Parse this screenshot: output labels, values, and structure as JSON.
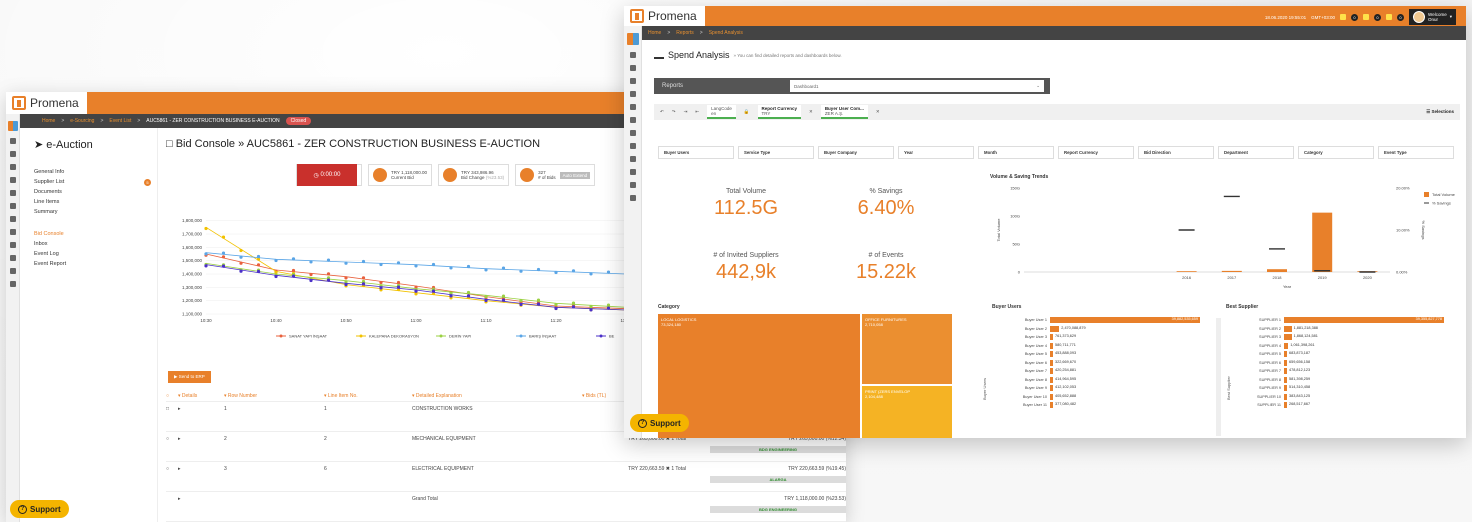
{
  "back": {
    "logo": "Promena",
    "breadcrumb": {
      "home": "Home",
      "sep1": ">",
      "sourcing": "e-Sourcing",
      "sep2": ">",
      "eventlist": "Event List",
      "sep3": ">",
      "current": "AUC5861 - ZER CONSTRUCTION BUSINESS E-AUCTION",
      "status": "Closed"
    },
    "nav_title": "e-Auction",
    "nav_items": [
      "General Info",
      "Supplier List",
      "Documents",
      "Line Items",
      "Summary",
      "Bid Console",
      "Inbox",
      "Event Log",
      "Event Report"
    ],
    "supplier_badge": "5",
    "page_title": "Bid Console » AUC5861 - ZER CONSTRUCTION BUSINESS E-AUCTION",
    "timer": "0:00:00",
    "current_bid_value": "TRY 1,118,000.00",
    "current_bid_label": "Current Bid",
    "bid_change_value": "TRY 343,986.96",
    "bid_change_pct": "(%23.53)",
    "bid_change_label": "Bid Change",
    "bids_count": "327",
    "bids_label": "# of Bids",
    "status_tag": "Auto Extend",
    "yticks": [
      "1,800,000",
      "1,700,000",
      "1,600,000",
      "1,500,000",
      "1,400,000",
      "1,300,000",
      "1,200,000",
      "1,100,000"
    ],
    "xticks": [
      "10:30",
      "10:40",
      "10:50",
      "11:00",
      "11:10",
      "11:20",
      "11:30"
    ],
    "legend": [
      "SANAT YAPI İNŞAAT",
      "KALEPANA DEKORASYON",
      "DERİN YAPI",
      "BARIŞ İNŞAAT",
      "BE"
    ],
    "send_button": "Send to ERP",
    "table_headers": [
      "",
      "Details",
      "Row Number",
      "Line Item No.",
      "Detailed Explanation",
      "Bids (TL)"
    ],
    "rows": [
      {
        "row": "1",
        "item": "1",
        "desc": "CONSTRUCTION WORKS",
        "total": "",
        "bid": "",
        "supplier": ""
      },
      {
        "row": "2",
        "item": "2",
        "desc": "MECHANICAL EQUIPMENT",
        "total": "TRY 265,000.00 ✖ 1 Total",
        "bid": "TRY 265,000.00 (%12.34)",
        "supplier": "BDG ENGINEERING"
      },
      {
        "row": "3",
        "item": "6",
        "desc": "ELECTRICAL EQUIPMENT",
        "total": "TRY 220,663.59 ✖ 1 Total",
        "bid": "TRY 220,663.59 (%19.45)",
        "supplier": "ALARGA"
      }
    ],
    "grand_total_label": "Grand Total",
    "grand_total_bid": "TRY 1,118,000.00 (%23.53)",
    "grand_total_supplier": "BDG ENGINEERING",
    "support": "Support"
  },
  "front": {
    "logo": "Promena",
    "datetime": "18.06.2020 19:55:01",
    "tz": "GMT+03:00",
    "notif_counts": [
      "0",
      "0",
      "0"
    ],
    "welcome": "Welcome",
    "user": "Onur",
    "breadcrumb": {
      "home": "Home",
      "sep1": ">",
      "reports": "Reports",
      "sep2": ">",
      "current": "Spend Analysis"
    },
    "title": "Spend Analysis",
    "subtitle": "» You can find detailed reports and dashboards below.",
    "reports_label": "Reports",
    "dashboard": "Dashboard1",
    "tool_chips": [
      {
        "label": "LangCode",
        "value": "en"
      },
      {
        "label": "Report Currency",
        "value": "TRY"
      },
      {
        "label": "Buyer User Com...",
        "value": "ZER A.Ş."
      }
    ],
    "selections": "Selections",
    "filters": [
      "Buyer Users",
      "Service Type",
      "Buyer Company",
      "Year",
      "Month",
      "Report Currency",
      "Bid Direction",
      "Department",
      "Category",
      "Event Type"
    ],
    "kpis": [
      {
        "label": "Total Volume",
        "value": "112.5G"
      },
      {
        "label": "% Savings",
        "value": "6.40%"
      },
      {
        "label": "# of Invited Suppliers",
        "value": "442,9k"
      },
      {
        "label": "# of Events",
        "value": "15.22k"
      }
    ],
    "trend_title": "Volume & Saving Trends",
    "trend_ylabel": "Total Volume",
    "trend_y2label": "% Savings",
    "trend_yticks": [
      "150G",
      "100G",
      "50G",
      "0"
    ],
    "trend_y2ticks": [
      "20.00%",
      "10.00%",
      "0.00%"
    ],
    "trend_xlabel": "Year",
    "trend_legend": [
      "Total Volume",
      "% Savings"
    ],
    "category_title": "Category",
    "treemap": [
      {
        "name": "LOCAL LOGISTICS",
        "value": "73,324,180"
      },
      {
        "name": "OFFICE FURNITURES",
        "value": "2,710,058"
      },
      {
        "name": "PRINT (ZERS ENVELOP",
        "value": "2,104,488"
      }
    ],
    "buyer_users_title": "Buyer Users",
    "buyer_users_axis": "Buyer Users",
    "buyer_users": [
      {
        "name": "Buyer User 1",
        "value": "39,882,535,659"
      },
      {
        "name": "Buyer User 2",
        "value": "2,470,088,879"
      },
      {
        "name": "Buyer User 3",
        "value": "761,373,629"
      },
      {
        "name": "Buyer User 4",
        "value": "580,711,771"
      },
      {
        "name": "Buyer User 5",
        "value": "453,888,093"
      },
      {
        "name": "Buyer User 6",
        "value": "322,669,670"
      },
      {
        "name": "Buyer User 7",
        "value": "420,254,881"
      },
      {
        "name": "Buyer User 8",
        "value": "414,964,595"
      },
      {
        "name": "Buyer User 9",
        "value": "412,102,053"
      },
      {
        "name": "Buyer User 10",
        "value": "405,652,888"
      },
      {
        "name": "Buyer User 11",
        "value": "377,080,482"
      }
    ],
    "best_supplier_title": "Best Supplier",
    "best_supplier_axis": "Best Supplier",
    "suppliers": [
      {
        "name": "SUPPLIER 1",
        "value": "39,355,827,778"
      },
      {
        "name": "SUPPLIER 2",
        "value": "1,881,218,388"
      },
      {
        "name": "SUPPLIER 3",
        "value": "1,868,124,581"
      },
      {
        "name": "SUPPLIER 4",
        "value": "1,061,398,261"
      },
      {
        "name": "SUPPLIER 5",
        "value": "683,873,187"
      },
      {
        "name": "SUPPLIER 6",
        "value": "659,656,158"
      },
      {
        "name": "SUPPLIER 7",
        "value": "478,812,123"
      },
      {
        "name": "SUPPLIER 8",
        "value": "581,398,259"
      },
      {
        "name": "SUPPLIER 9",
        "value": "514,310,458"
      },
      {
        "name": "SUPPLIER 10",
        "value": "383,843,125"
      },
      {
        "name": "SUPPLIER 11",
        "value": "268,517,667"
      }
    ],
    "support": "Support"
  },
  "chart_data": [
    {
      "type": "line",
      "ylim": [
        1100000,
        1850000
      ],
      "x": [
        "10:30",
        "10:40",
        "10:50",
        "11:00",
        "11:10",
        "11:20",
        "11:30"
      ],
      "series": [
        {
          "name": "SANAT YAPI İNŞAAT",
          "values": [
            1550000,
            1430000,
            1380000,
            1310000,
            1230000,
            1160000,
            1140000
          ]
        },
        {
          "name": "KALEPANA DEKORASYON",
          "values": [
            1750000,
            1420000,
            1320000,
            1260000,
            1200000,
            1150000,
            1130000
          ]
        },
        {
          "name": "DERİN YAPI",
          "values": [
            1480000,
            1400000,
            1350000,
            1290000,
            1240000,
            1180000,
            1150000
          ]
        },
        {
          "name": "BARIŞ İNŞAAT",
          "values": [
            1560000,
            1510000,
            1490000,
            1470000,
            1440000,
            1420000,
            1400000
          ]
        },
        {
          "name": "BE",
          "values": [
            1470000,
            1390000,
            1330000,
            1280000,
            1210000,
            1150000,
            1130000
          ]
        }
      ],
      "colors": [
        "#e8603c",
        "#f2c200",
        "#9bd143",
        "#5aa5e6",
        "#4b30c9"
      ]
    },
    {
      "type": "bar",
      "title": "Volume & Saving Trends",
      "categories": [
        "2016",
        "2017",
        "2018",
        "2019",
        "2020"
      ],
      "values": [
        0,
        2,
        5,
        106,
        0
      ],
      "ylim": [
        0,
        150
      ],
      "ylabel": "Total Volume",
      "y2label": "% Savings",
      "y2lim": [
        0,
        20
      ],
      "savings": [
        10,
        18,
        5.5,
        0.3,
        0
      ],
      "xlabel": "Year"
    }
  ],
  "colors": {
    "brand": "#e8802a",
    "dark": "#444444",
    "support": "#f4b400"
  }
}
